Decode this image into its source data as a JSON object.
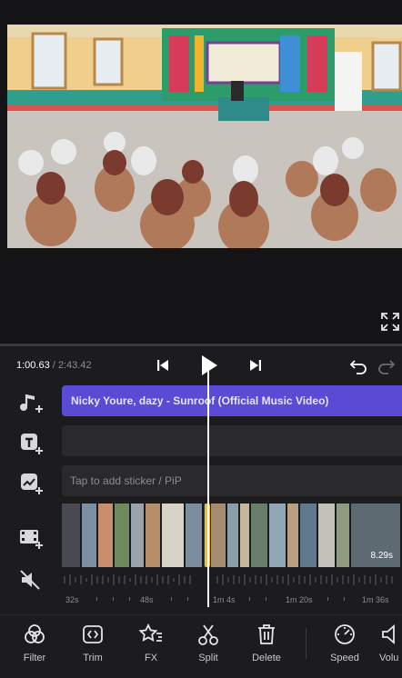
{
  "colors": {
    "accent": "#5b4bd4",
    "split_handle": "#f4c21b",
    "background": "#1c1c1e"
  },
  "playback": {
    "current_time": "1:00.63",
    "separator": " / ",
    "total_time": "2:43.42"
  },
  "tracks": {
    "music_title": "Nicky Youre, dazy - Sunroof (Official Music Video)",
    "sticker_placeholder": "Tap to add sticker / PiP"
  },
  "clips": {
    "last_clip_duration": "8.29s"
  },
  "ruler": {
    "labels": [
      "32s",
      "48s",
      "1m 4s",
      "1m 20s",
      "1m 36s"
    ]
  },
  "icons": {
    "row": [
      "music-add-icon",
      "text-add-icon",
      "sticker-add-icon",
      "video-add-icon",
      "mute-icon"
    ],
    "transport": [
      "skip-back-icon",
      "play-icon",
      "skip-forward-icon",
      "undo-icon",
      "redo-icon"
    ]
  },
  "toolbar": {
    "items": [
      {
        "label": "Filter",
        "icon": "filter-icon"
      },
      {
        "label": "Trim",
        "icon": "trim-icon"
      },
      {
        "label": "FX",
        "icon": "fx-icon"
      },
      {
        "label": "Split",
        "icon": "split-icon"
      },
      {
        "label": "Delete",
        "icon": "delete-icon"
      },
      {
        "label": "Speed",
        "icon": "speed-icon"
      },
      {
        "label": "Volu",
        "icon": "volume-icon"
      }
    ]
  }
}
